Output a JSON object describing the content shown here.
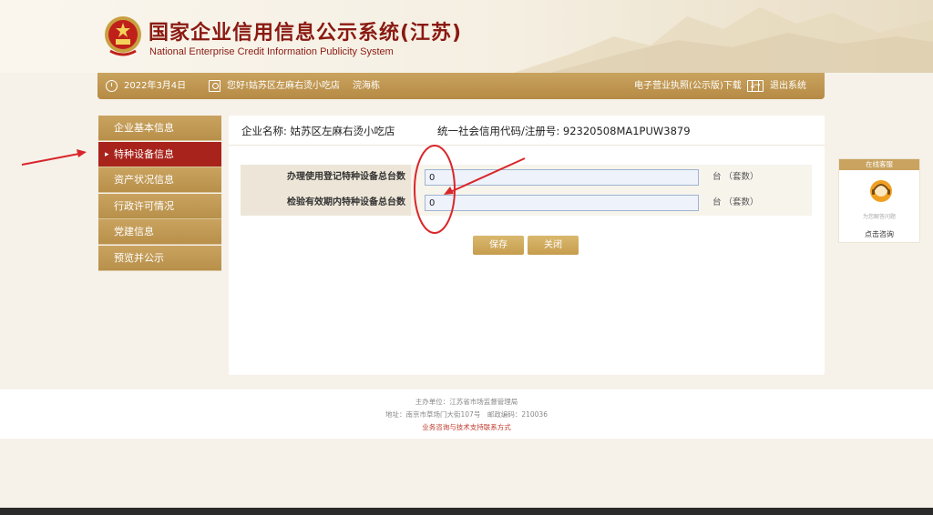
{
  "header": {
    "title_cn": "国家企业信用信息公示系统(江苏)",
    "title_en": "National Enterprise Credit Information Publicity System"
  },
  "toolbar": {
    "date": "2022年3月4日",
    "greeting": "您好!姑苏区左麻右烫小吃店",
    "user": "浣海栋",
    "download_label": "电子营业执照(公示版)下载",
    "logout_label": "退出系统"
  },
  "sidebar": {
    "items": [
      {
        "label": "企业基本信息"
      },
      {
        "label": "特种设备信息"
      },
      {
        "label": "资产状况信息"
      },
      {
        "label": "行政许可情况"
      },
      {
        "label": "党建信息"
      },
      {
        "label": "预览并公示"
      }
    ],
    "active_index": 1
  },
  "main": {
    "company_label": "企业名称:",
    "company_name": "姑苏区左麻右烫小吃店",
    "credit_label": "统一社会信用代码/注册号:",
    "credit_code": "92320508MA1PUW3879",
    "rows": [
      {
        "label": "办理使用登记特种设备总台数",
        "value": "0",
        "unit": "台 （套数）"
      },
      {
        "label": "检验有效期内特种设备总台数",
        "value": "0",
        "unit": "台 （套数）"
      }
    ],
    "save_label": "保存",
    "close_label": "关闭"
  },
  "service": {
    "title": "在线客服",
    "subtitle": "为您解答问题",
    "link": "点击咨询"
  },
  "footer": {
    "sponsor": "主办单位：江苏省市场监督管理局",
    "address": "地址：南京市草场门大街107号　邮政编码：210036",
    "support_link": "业务咨询与技术支持联系方式"
  },
  "colors": {
    "brand_red": "#8a1a12",
    "gold": "#c9a35f",
    "active_red": "#a8231b",
    "annotation_red": "#d9262b"
  }
}
